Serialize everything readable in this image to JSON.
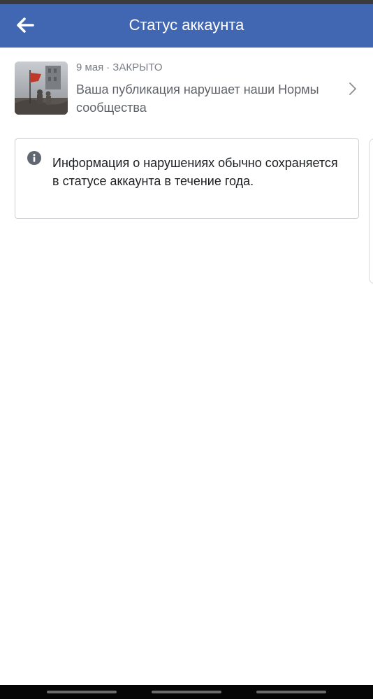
{
  "header": {
    "title": "Статус аккаунта",
    "back_icon": "arrow-left-icon"
  },
  "colors": {
    "header_bg": "#4267b2",
    "meta_text": "#7a7f86",
    "body_text": "#1c1e21"
  },
  "post": {
    "date": "9 мая",
    "separator": "·",
    "status": "ЗАКРЫТО",
    "text": "Ваша публикация нарушает наши Нормы сообщества",
    "chevron_icon": "chevron-right-icon"
  },
  "info": {
    "icon": "info-icon",
    "text": "Информация о нарушениях обычно сохраняется в статусе аккаунта в течение года."
  }
}
